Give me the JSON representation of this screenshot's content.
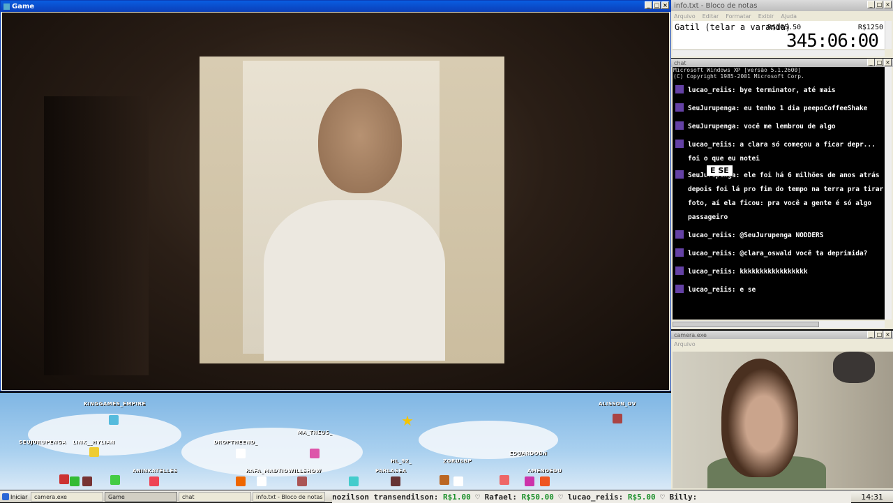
{
  "game_window": {
    "title": "Game"
  },
  "notepad": {
    "title": "info.txt - Bloco de notas",
    "menu": [
      "Arquivo",
      "Editar",
      "Formatar",
      "Exibir",
      "Ajuda"
    ],
    "line1": "Gatil (telar a varanda)",
    "price": "R$165.50",
    "goal": "R$1250",
    "timer": "345:06:00"
  },
  "chat": {
    "title": "chat",
    "system_lines": [
      "Microsoft Windows XP [versão 5.1.2600]",
      "(C) Copyright 1985-2001 Microsoft Corp."
    ],
    "messages": [
      {
        "user": "lucao_reiis",
        "text": "bye terminator, até mais"
      },
      {
        "user": "SeuJurupenga",
        "text": "eu tenho 1 dia peepoCoffeeShake"
      },
      {
        "user": "SeuJurupenga",
        "text": "você me lembrou de algo"
      },
      {
        "user": "lucao_reiis",
        "text": "a clara só começou a ficar depr... foi o que eu notei"
      },
      {
        "user": "SeuJurupenga",
        "text": "ele foi há 6 milhões de anos atrás depois foi lá pro fim do tempo na terra pra tirar foto, aí ela ficou: pra você a gente é só algo passageiro"
      },
      {
        "user": "lucao_reiis",
        "text": "@SeuJurupenga NODDERS"
      },
      {
        "user": "lucao_reiis",
        "text": "@clara_oswald você ta deprimida?"
      },
      {
        "user": "lucao_reiis",
        "text": "kkkkkkkkkkkkkkkkk"
      },
      {
        "user": "lucao_reiis",
        "text": "e se"
      }
    ],
    "popup": "E SE"
  },
  "camera": {
    "title": "camera.exe",
    "menu": "Arquivo"
  },
  "overlay": {
    "usernames": [
      {
        "name": "KINGGAMES_EMPIRE"
      },
      {
        "name": "ALISSON_OV"
      },
      {
        "name": "SEUJURUPENGA"
      },
      {
        "name": "LINK__HYLIAN"
      },
      {
        "name": "DROPTHEEND_"
      },
      {
        "name": "MA_THEUS_"
      },
      {
        "name": "EDUARDOBN"
      },
      {
        "name": "HL_92_"
      },
      {
        "name": "ZORUSBP"
      },
      {
        "name": "ANINKATELLES"
      },
      {
        "name": "RAFA_MADTIOWILLSHOW"
      },
      {
        "name": "PARLASEA"
      },
      {
        "name": "AMENOEDU"
      }
    ]
  },
  "taskbar": {
    "start": "Iniciar",
    "items": [
      {
        "label": "camera.exe"
      },
      {
        "label": "Game",
        "active": true
      },
      {
        "label": "chat"
      },
      {
        "label": "info.txt - Bloco de notas"
      }
    ],
    "ticker": [
      {
        "name": "nozilson transendilson:",
        "amount": "R$1.00"
      },
      {
        "name": "Rafael:",
        "amount": "R$50.00"
      },
      {
        "name": "lucao_reiis:",
        "amount": "R$5.00"
      },
      {
        "name": "Billy:",
        "amount": ""
      }
    ],
    "clock": "14:31"
  },
  "colors": {
    "title_blue": "#0b3fb8",
    "chat_badge": "#6441a5",
    "money_green": "#1a8f2a"
  }
}
